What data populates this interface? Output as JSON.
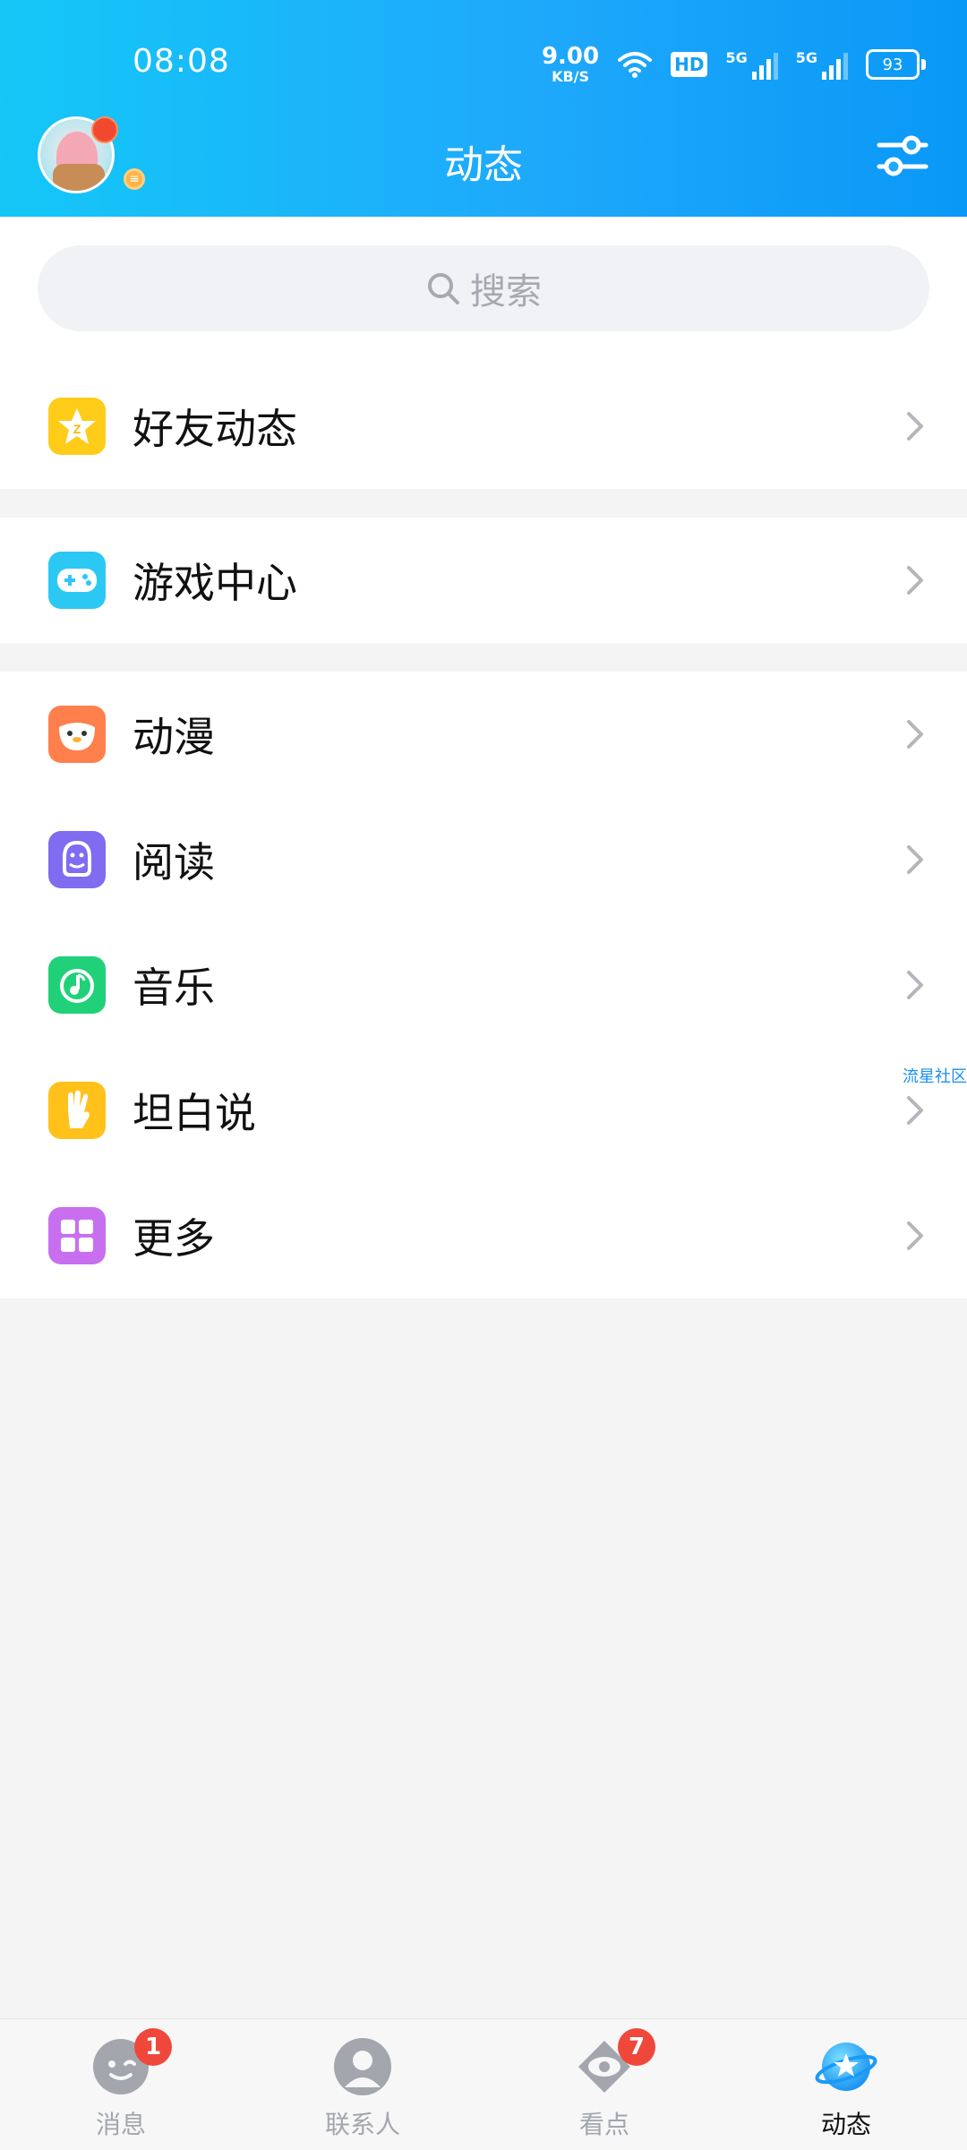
{
  "status": {
    "time": "08:08",
    "net_speed": "9.00",
    "net_unit": "KB/S",
    "hd": "HD",
    "sim1": "5G",
    "sim2": "5G",
    "battery": "93"
  },
  "header": {
    "title": "动态"
  },
  "search": {
    "placeholder": "搜索"
  },
  "groups": [
    {
      "items": [
        {
          "label": "好友动态",
          "icon": "qzone-star-icon",
          "color": "#ffcc1a"
        }
      ]
    },
    {
      "items": [
        {
          "label": "游戏中心",
          "icon": "gamepad-icon",
          "color": "#2cc8f4"
        }
      ]
    },
    {
      "items": [
        {
          "label": "动漫",
          "icon": "comic-face-icon",
          "color": "#ff7f4d"
        },
        {
          "label": "阅读",
          "icon": "reading-penguin-icon",
          "color": "#7f6cf0"
        },
        {
          "label": "音乐",
          "icon": "music-note-icon",
          "color": "#20d17a"
        },
        {
          "label": "坦白说",
          "icon": "hand-icon",
          "color": "#ffc11a"
        },
        {
          "label": "更多",
          "icon": "grid-icon",
          "color": "#c86ff0"
        }
      ]
    }
  ],
  "side_tag": "流星社区",
  "tabbar": [
    {
      "label": "消息",
      "badge": "1",
      "icon": "message-face-icon"
    },
    {
      "label": "联系人",
      "badge": "",
      "icon": "contact-person-icon"
    },
    {
      "label": "看点",
      "badge": "7",
      "icon": "eye-icon"
    },
    {
      "label": "动态",
      "badge": "",
      "icon": "star-planet-icon",
      "active": true
    }
  ],
  "colors": {
    "header_start": "#14c7f7",
    "header_end": "#0a98f7",
    "badge": "#f0473b"
  }
}
